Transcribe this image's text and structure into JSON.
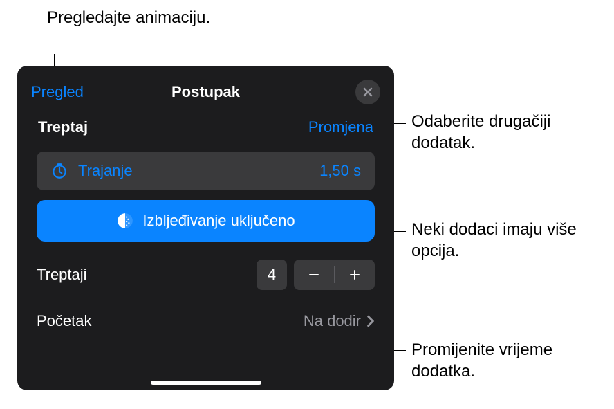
{
  "callouts": {
    "preview": "Pregledajte animaciju.",
    "change": "Odaberite drugačiji dodatak.",
    "options": "Neki dodaci imaju više opcija.",
    "timing": "Promijenite vrijeme dodatka."
  },
  "panel": {
    "preview_link": "Pregled",
    "title": "Postupak",
    "effect_name": "Treptaj",
    "change_link": "Promjena",
    "duration_label": "Trajanje",
    "duration_value": "1,50 s",
    "fade_label": "Izbljeđivanje uključeno",
    "blinks_label": "Treptaji",
    "blinks_count": "4",
    "start_label": "Početak",
    "start_value": "Na dodir"
  }
}
